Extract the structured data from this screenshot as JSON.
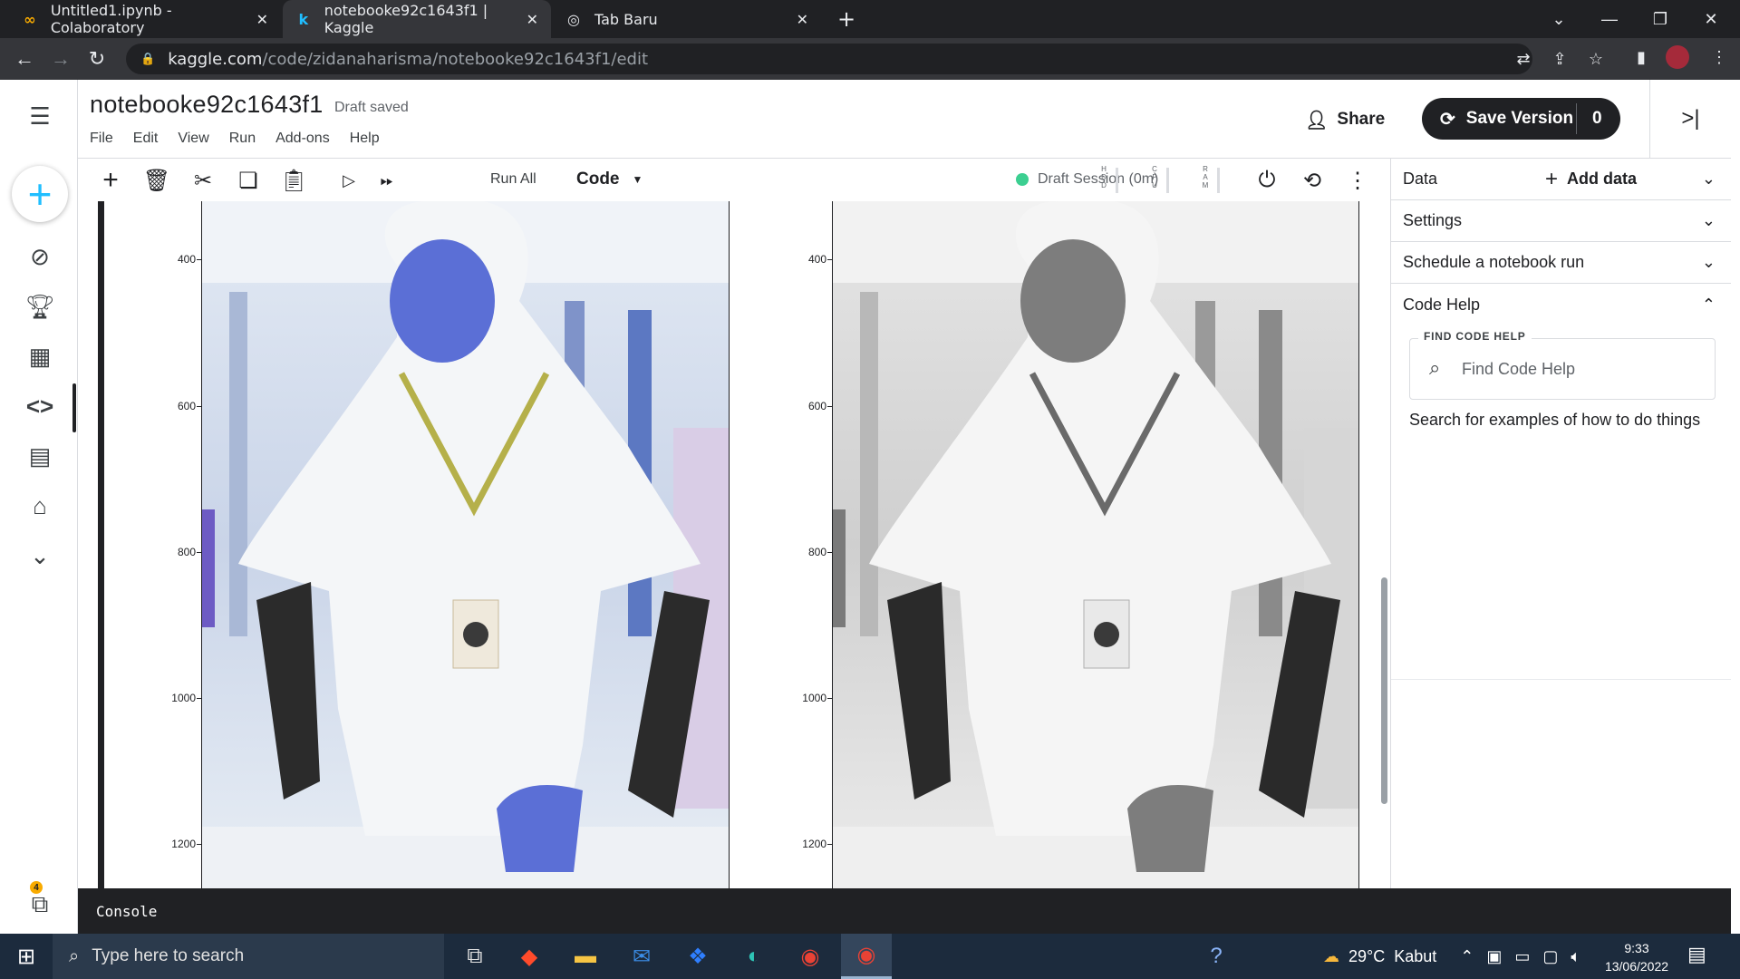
{
  "browser": {
    "tabs": [
      {
        "title": "Untitled1.ipynb - Colaboratory",
        "icon": "colab-icon"
      },
      {
        "title": "notebooke92c1643f1 | Kaggle",
        "icon": "kaggle-icon"
      },
      {
        "title": "Tab Baru",
        "icon": "chrome-icon"
      }
    ],
    "url_host": "kaggle.com",
    "url_path": "/code/zidanaharisma/notebooke92c1643f1/edit"
  },
  "notebook": {
    "title": "notebooke92c1643f1",
    "status": "Draft saved",
    "menu": [
      "File",
      "Edit",
      "View",
      "Run",
      "Add-ons",
      "Help"
    ],
    "share_label": "Share",
    "save_label": "Save Version",
    "save_count": "0"
  },
  "toolbar": {
    "run_all": "Run All",
    "cell_type": "Code",
    "session": "Draft Session (0m)",
    "meters": [
      "HDD",
      "CPU",
      "RAM"
    ]
  },
  "plots": {
    "yticks": [
      "400",
      "600",
      "800",
      "1000",
      "1200"
    ]
  },
  "right_panel": {
    "data_label": "Data",
    "add_data": "Add data",
    "settings": "Settings",
    "schedule": "Schedule a notebook run",
    "code_help": "Code Help",
    "find_legend": "FIND CODE HELP",
    "find_placeholder": "Find Code Help",
    "find_hint": "Search for examples of how to do things"
  },
  "console": {
    "label": "Console"
  },
  "left_badge": "4",
  "taskbar": {
    "search_placeholder": "Type here to search",
    "weather": "29°C  Kabut",
    "time": "9:33",
    "date": "13/06/2022"
  },
  "colors": {
    "accent": "#20beff",
    "session_dot": "#3ccf91",
    "dark": "#202124"
  }
}
